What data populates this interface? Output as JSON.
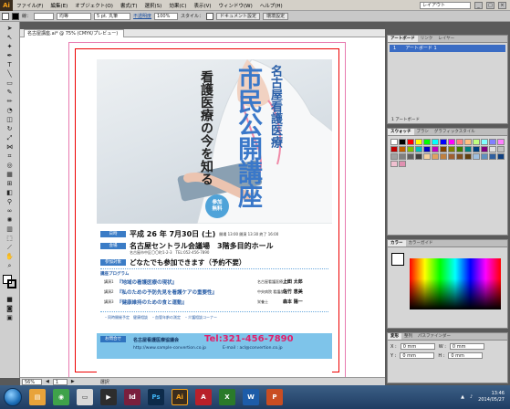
{
  "app": {
    "logo": "Ai"
  },
  "menu": {
    "items": [
      "ファイル(F)",
      "編集(E)",
      "オブジェクト(O)",
      "書式(T)",
      "選択(S)",
      "効果(C)",
      "表示(V)",
      "ウィンドウ(W)",
      "ヘルプ(H)"
    ],
    "workspace": "レイアウト"
  },
  "control": {
    "stroke_label": "線：",
    "brush": "均等",
    "points": "5 pt. 丸筆",
    "opacity_label": "不透明度",
    "opacity_value": "100%",
    "style_label": "スタイル：",
    "doc_setup": "ドキュメント設定",
    "prefs": "環境設定"
  },
  "document": {
    "tab_title": "名古屋講座.ai* @ 75% (CMYK/プレビュー)"
  },
  "poster": {
    "city": "名古屋看護医療",
    "title": "市民公開講座",
    "subtitle": "看護医療の今を知る",
    "badge_line1": "参加",
    "badge_line2": "無料",
    "labels": {
      "date": "日時",
      "venue": "会場",
      "target": "参加対象"
    },
    "date": "平成 26 年 7月30日 (土)",
    "time": "開場 13:00 開演 13:30 終了 16:00",
    "venue": "名古屋セントラル会議場　3階多目的ホール",
    "address": "名古屋市中区〇〇町1-2-3　TEL:052-456-7890",
    "target": "どなたでも参加できます（予約不要）",
    "program_head": "講座プログラム",
    "program": [
      {
        "num": "講演1",
        "title": "『地域の看護医療の現状』",
        "speaker_role": "名古屋看護医療大学",
        "speaker": "上田 太郎"
      },
      {
        "num": "講演2",
        "title": "『私のための予防先見を看護ケアの重要性』",
        "speaker_role": "中央病院 看護部長",
        "speaker": "佐竹 恵美"
      },
      {
        "num": "講演3",
        "title": "『健康維持のための食と運動』",
        "speaker_role": "栄養士",
        "speaker": "森本 陽一"
      }
    ],
    "program_note": "・同時開催予定　健康相談　・血管年齢の測定　・介護相談コーナー",
    "footer": {
      "label": "お問合せ",
      "org": "名古屋看護医療協議会",
      "tel": "Tel:321-456-7890",
      "url": "http://www.sample-convertion.co.jp",
      "mail": "E-mail : acl@convertion.co.jp"
    }
  },
  "statusbar": {
    "zoom": "56%",
    "page": "1",
    "mode": "選択"
  },
  "panels": {
    "artboards": {
      "tabs": [
        "アートボード",
        "リンク",
        "レイヤー"
      ],
      "row_num": "1",
      "row_name": "アートボード 1",
      "footer": "1 アートボード"
    },
    "swatches": {
      "tabs": [
        "スウォッチ",
        "ブラシ",
        "グラフィックスタイル"
      ]
    },
    "color": {
      "tabs": [
        "カラー",
        "カラーガイド"
      ]
    },
    "transform": {
      "tabs": [
        "変形",
        "整列",
        "パスファインダー"
      ],
      "x_label": "X :",
      "x": "0 mm",
      "y_label": "Y :",
      "y": "0 mm",
      "w_label": "W :",
      "w": "0 mm",
      "h_label": "H :",
      "h": "0 mm"
    },
    "bottom": {
      "tabs": [
        "文字",
        "段落",
        "OpenType"
      ]
    }
  },
  "taskbar": {
    "time": "13:46",
    "date": "2014/05/27"
  },
  "swatch_colors": [
    "#ffffff",
    "#000000",
    "#ff0000",
    "#ffff00",
    "#00ff00",
    "#00ffff",
    "#0000ff",
    "#ff00ff",
    "#ff8080",
    "#ffbf80",
    "#c0ff80",
    "#80ffff",
    "#8080ff",
    "#ff80ff",
    "#c00000",
    "#c06000",
    "#80c000",
    "#00c0c0",
    "#0000c0",
    "#c000c0",
    "#804000",
    "#808000",
    "#408000",
    "#008080",
    "#004080",
    "#800080",
    "#e0e0e0",
    "#c0c0c0",
    "#a0a0a0",
    "#808080",
    "#606060",
    "#404040",
    "#f5d0a0",
    "#e0a060",
    "#c08040",
    "#a06030",
    "#805020",
    "#604010",
    "#a0c0e0",
    "#6090c0",
    "#3060a0",
    "#104080",
    "#f0c0d0",
    "#e090b0"
  ]
}
